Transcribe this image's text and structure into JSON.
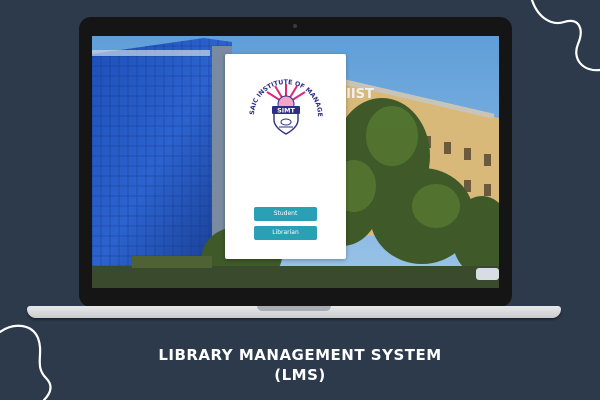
{
  "login_card": {
    "logo_text": "SAIC INSTITUTE OF MANAGEMENT & TECHNOLOGY",
    "logo_mark": "SIMT",
    "buttons": [
      {
        "label": "Student"
      },
      {
        "label": "Librarian"
      }
    ],
    "button_color": "#2aa0b4"
  },
  "background_sign": "IIST",
  "caption": {
    "line1": "LIBRARY MANAGEMENT SYSTEM",
    "line2": "(LMS)"
  },
  "colors": {
    "page_background": "#2c3a4b",
    "accent": "#2aa0b4"
  }
}
